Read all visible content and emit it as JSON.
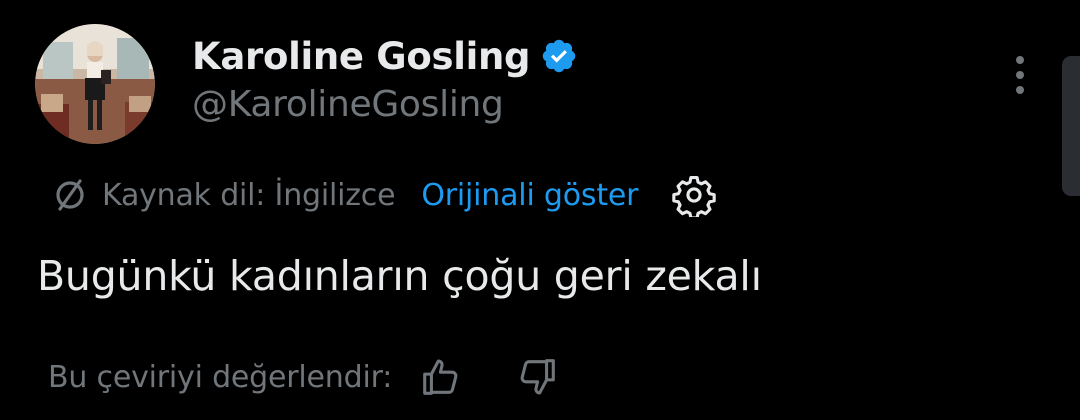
{
  "author": {
    "display_name": "Karoline Gosling",
    "handle": "@KarolineGosling",
    "verified": true,
    "avatar_icon": "profile-photo"
  },
  "translation": {
    "source_language_label": "Kaynak dil: İngilizce",
    "show_original_label": "Orijinali göster",
    "translate_icon": "translate-icon",
    "settings_icon": "gear-icon"
  },
  "tweet": {
    "text": "Bugünkü kadınların çoğu geri zekalı"
  },
  "feedback": {
    "label": "Bu çeviriyi değerlendir:",
    "up_icon": "thumbs-up-icon",
    "down_icon": "thumbs-down-icon"
  },
  "colors": {
    "background": "#000000",
    "primary_text": "#e7e9ea",
    "secondary_text": "#71767b",
    "accent": "#1d9bf0"
  }
}
